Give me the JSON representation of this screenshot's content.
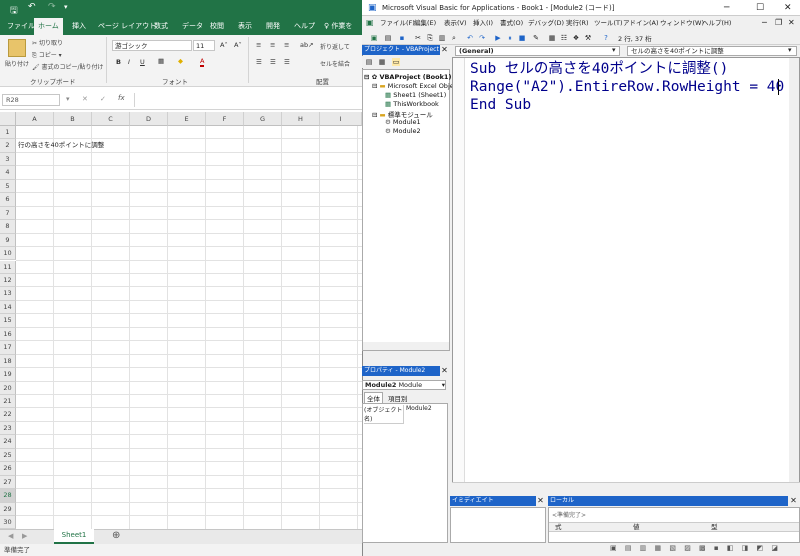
{
  "excel": {
    "tabs": [
      "ファイル",
      "ホーム",
      "挿入",
      "ページ レイアウト",
      "数式",
      "データ",
      "校閲",
      "表示",
      "開発",
      "ヘルプ",
      "作業を"
    ],
    "clipboard": {
      "paste": "貼り付け",
      "cut": "切り取り",
      "copy": "コピー ▾",
      "format_painter": "書式のコピー/貼り付け",
      "group": "クリップボード"
    },
    "font": {
      "name": "游ゴシック",
      "size": "11",
      "group": "フォント",
      "bold": "B",
      "italic": "I",
      "underline": "U"
    },
    "alignment": {
      "wrap": "折り返して",
      "merge": "セルを結合",
      "group": "配置"
    },
    "name_box": "R28",
    "fx": "fx",
    "columns": [
      "A",
      "B",
      "C",
      "D",
      "E",
      "F",
      "G",
      "H",
      "I"
    ],
    "rows": [
      "1",
      "2",
      "3",
      "4",
      "5",
      "6",
      "7",
      "8",
      "9",
      "10",
      "11",
      "12",
      "13",
      "14",
      "15",
      "16",
      "17",
      "18",
      "19",
      "20",
      "21",
      "22",
      "23",
      "24",
      "25",
      "26",
      "27",
      "28",
      "29",
      "30"
    ],
    "cell_a2": "行の高さを40ポイントに調整",
    "sheet_tab": "Sheet1",
    "status": "準備完了"
  },
  "vbe": {
    "title": "Microsoft Visual Basic for Applications - Book1 - [Module2 (コード)]",
    "menu": [
      "ファイル(F)",
      "編集(E)",
      "表示(V)",
      "挿入(I)",
      "書式(O)",
      "デバッグ(D)",
      "実行(R)",
      "ツール(T)",
      "アドイン(A)",
      "ウィンドウ(W)",
      "ヘルプ(H)"
    ],
    "position": "2 行, 37 桁",
    "project_panel_title": "プロジェクト - VBAProject",
    "tree": {
      "root": "VBAProject (Book1)",
      "excel_objects": "Microsoft Excel Obje",
      "sheet1": "Sheet1 (Sheet1)",
      "thisworkbook": "ThisWorkbook",
      "modules": "標準モジュール",
      "module1": "Module1",
      "module2": "Module2"
    },
    "properties_title": "プロパティ - Module2",
    "properties_object": "Module2",
    "properties_type": "Module",
    "prop_tabs": [
      "全体",
      "項目別"
    ],
    "prop_name_label": "(オブジェクト名)",
    "prop_name_value": "Module2",
    "object_dropdown": "(General)",
    "proc_dropdown": "セルの高さを40ポイントに調整",
    "code": {
      "line1_kw": "Sub",
      "line1_rest": " セルの高さを40ポイントに調整()",
      "line2": "Range(\"A2\").EntireRow.RowHeight = 40",
      "line3": "End Sub"
    },
    "immediate_title": "イミディエイト",
    "locals_title": "ローカル",
    "locals_running": "<準備完了>",
    "locals_cols": [
      "式",
      "値",
      "型"
    ]
  }
}
